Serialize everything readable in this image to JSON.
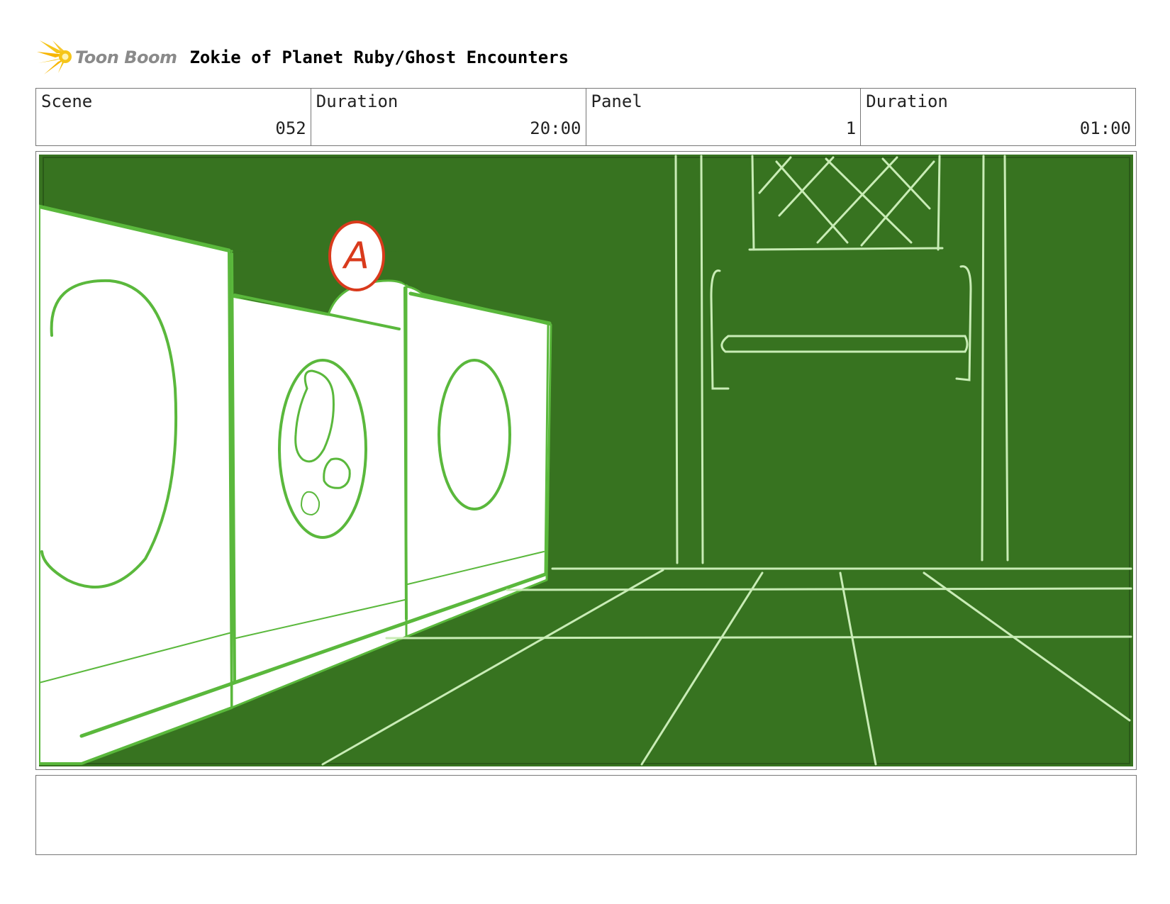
{
  "header": {
    "brand": "Toon Boom",
    "title": "Zokie of Planet Ruby/Ghost Encounters"
  },
  "info": {
    "scene_label": "Scene",
    "scene_value": "052",
    "scene_duration_label": "Duration",
    "scene_duration_value": "20:00",
    "panel_label": "Panel",
    "panel_value": "1",
    "panel_duration_label": "Duration",
    "panel_duration_value": "01:00"
  },
  "panel": {
    "marker_letter": "A"
  },
  "notes": {
    "text": ""
  },
  "colors": {
    "background_green": "#377320",
    "line_green": "#5ab83c",
    "light_line": "#c9ecb6",
    "marker_red": "#d93a1c",
    "brand_gray": "#8a8a8a",
    "logo_yellow": "#f5c518"
  }
}
